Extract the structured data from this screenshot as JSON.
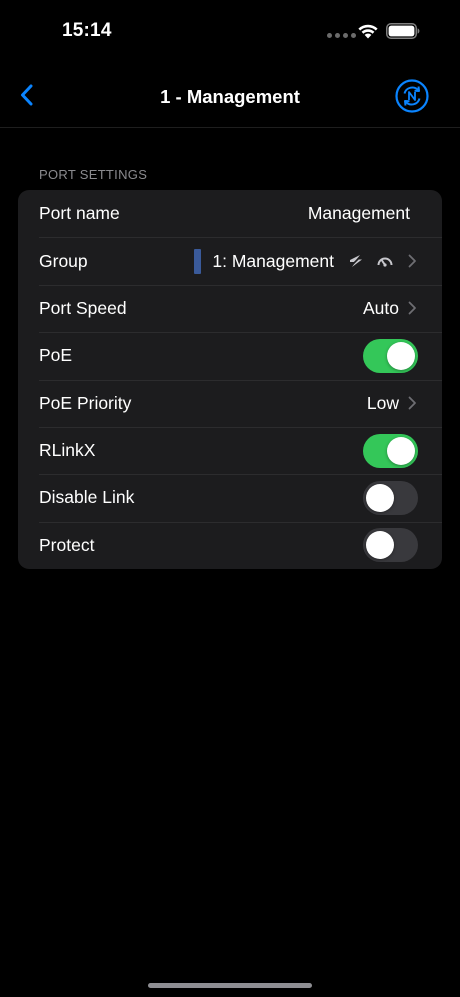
{
  "status_bar": {
    "time": "15:14"
  },
  "nav": {
    "title": "1 - Management",
    "accent_color": "#0a84ff"
  },
  "section": {
    "header": "PORT SETTINGS"
  },
  "settings": {
    "port_name": {
      "label": "Port name",
      "value": "Management"
    },
    "group": {
      "label": "Group",
      "value": "1: Management",
      "swatch_color": "#3a5a9a"
    },
    "port_speed": {
      "label": "Port Speed",
      "value": "Auto"
    },
    "poe": {
      "label": "PoE",
      "enabled": true
    },
    "poe_priority": {
      "label": "PoE Priority",
      "value": "Low"
    },
    "rlinkx": {
      "label": "RLinkX",
      "enabled": true
    },
    "disable_link": {
      "label": "Disable Link",
      "enabled": false
    },
    "protect": {
      "label": "Protect",
      "enabled": false
    }
  },
  "colors": {
    "toggle_on": "#34c759",
    "toggle_off": "#39393d"
  }
}
